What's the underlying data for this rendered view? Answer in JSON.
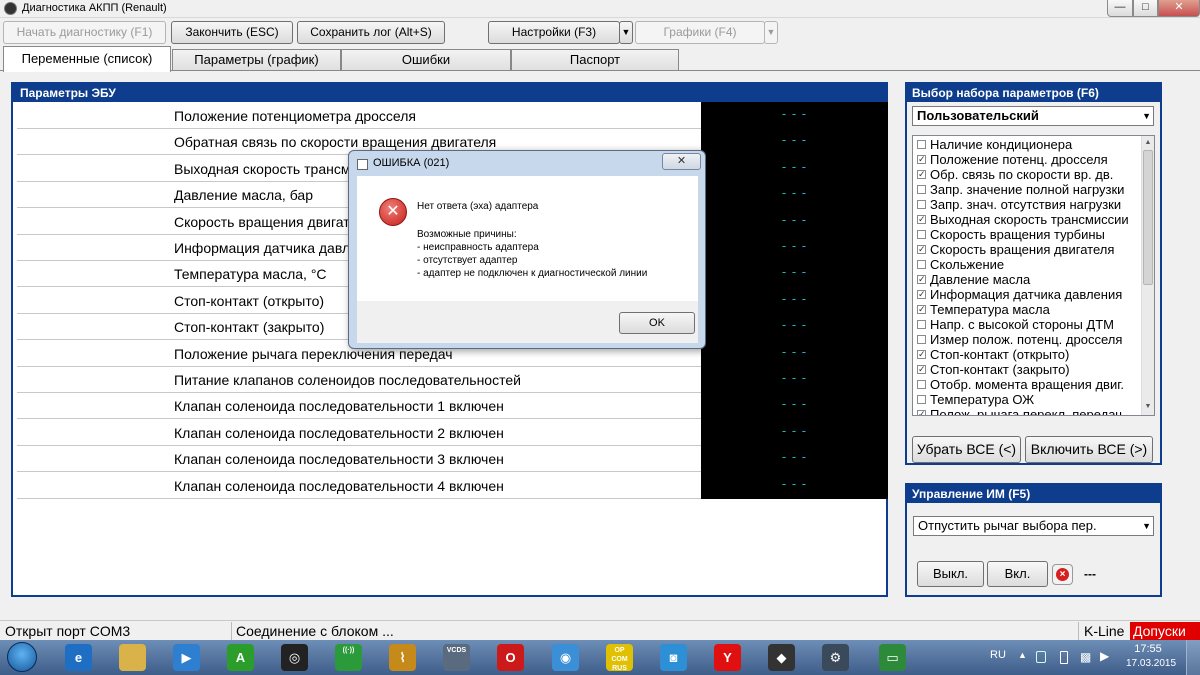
{
  "window": {
    "title": "Диагностика АКПП (Renault)"
  },
  "toolbar": {
    "start_diag": "Начать диагностику (F1)",
    "finish": "Закончить (ESC)",
    "save_log": "Сохранить лог (Alt+S)",
    "settings": "Настройки (F3)",
    "graphs": "Графики (F4)"
  },
  "tabs": [
    {
      "label": "Переменные (список)"
    },
    {
      "label": "Параметры (график)"
    },
    {
      "label": "Ошибки"
    },
    {
      "label": "Паспорт"
    }
  ],
  "ecu_panel": {
    "title": "Параметры ЭБУ",
    "rows": [
      {
        "name": "Положение потенциометра дросселя",
        "value": "- - -"
      },
      {
        "name": "Обратная  связь по скорости вращения двигателя",
        "value": "- - -"
      },
      {
        "name": "Выходная скорость трансмиссии",
        "value": "- - -"
      },
      {
        "name": "Давление масла, бар",
        "value": "- - -"
      },
      {
        "name": "Скорость вращения двигателя",
        "value": "- - -"
      },
      {
        "name": "Информация датчика давления",
        "value": "- - -"
      },
      {
        "name": "Температура масла, °C",
        "value": "- - -"
      },
      {
        "name": "Стоп-контакт (открыто)",
        "value": "- - -"
      },
      {
        "name": "Стоп-контакт (закрыто)",
        "value": "- - -"
      },
      {
        "name": "Положение рычага переключения передач",
        "value": "- - -"
      },
      {
        "name": "Питание клапанов соленоидов последовательностей",
        "value": "- - -"
      },
      {
        "name": "Клапан соленоида последовательности 1 включен",
        "value": "- - -"
      },
      {
        "name": "Клапан соленоида последовательности 2 включен",
        "value": "- - -"
      },
      {
        "name": "Клапан соленоида последовательности 3 включен",
        "value": "- - -"
      },
      {
        "name": "Клапан соленоида последовательности 4 включен",
        "value": "- - -"
      }
    ]
  },
  "param_set": {
    "title": "Выбор набора параметров (F6)",
    "selected": "Пользовательский",
    "items": [
      {
        "label": "Наличие кондиционера",
        "checked": false
      },
      {
        "label": "Положение потенц. дросселя",
        "checked": true
      },
      {
        "label": "Обр.  связь по скорости вр. дв.",
        "checked": true
      },
      {
        "label": "Запр. значение полной нагрузки",
        "checked": false
      },
      {
        "label": "Запр. знач. отсутствия нагрузки",
        "checked": false
      },
      {
        "label": "Выходная скорость трансмиссии",
        "checked": true
      },
      {
        "label": "Скорость вращения турбины",
        "checked": false
      },
      {
        "label": "Скорость вращения двигателя",
        "checked": true
      },
      {
        "label": "Скольжение",
        "checked": false
      },
      {
        "label": "Давление масла",
        "checked": true
      },
      {
        "label": "Информация датчика давления",
        "checked": true
      },
      {
        "label": "Температура масла",
        "checked": true
      },
      {
        "label": "Напр. с высокой стороны ДТМ",
        "checked": false
      },
      {
        "label": "Измер полож. потенц. дросселя",
        "checked": false
      },
      {
        "label": "Стоп-контакт (открыто)",
        "checked": true
      },
      {
        "label": "Стоп-контакт (закрыто)",
        "checked": true
      },
      {
        "label": "Отобр. момента вращения двиг.",
        "checked": false
      },
      {
        "label": "Температура ОЖ",
        "checked": false
      },
      {
        "label": "Полож. рычага перекл. передач",
        "checked": true
      }
    ],
    "remove_all": "Убрать ВСЕ (<)",
    "add_all": "Включить ВСЕ (>)"
  },
  "actuator": {
    "title": "Управление ИМ (F5)",
    "selected": "Отпустить рычаг выбора пер.",
    "off": "Выкл.",
    "on": "Вкл.",
    "state": "---"
  },
  "status": {
    "port": "Открыт порт COM3",
    "connection": "Соединение с блоком ...",
    "protocol": "K-Line",
    "admissions": "Допуски"
  },
  "dialog": {
    "title": "ОШИБКА (021)",
    "message": "Нет ответа (эха) адаптера",
    "reasons_title": "Возможные причины:",
    "reasons": [
      "- неисправность адаптера",
      "- отсутствует адаптер",
      "- адаптер не подключен к диагностической линии"
    ],
    "ok": "OK"
  },
  "taskbar": {
    "icons": [
      {
        "name": "explorer-icon",
        "color": "#1e6fc4",
        "glyph": "e"
      },
      {
        "name": "folder-icon",
        "color": "#d9b24a",
        "glyph": ""
      },
      {
        "name": "media-player-icon",
        "color": "#2f7fd0",
        "glyph": "▶"
      },
      {
        "name": "a-app-icon",
        "color": "#2a9d2a",
        "glyph": "A"
      },
      {
        "name": "disc-tool-icon",
        "color": "#222222",
        "glyph": "◎"
      },
      {
        "name": "radio-icon",
        "color": "#2a9a3a",
        "glyph": "((·))"
      },
      {
        "name": "pulse-icon",
        "color": "#c58a1a",
        "glyph": "⌇"
      },
      {
        "name": "vcds-icon",
        "color": "#5a6b80",
        "glyph": "VCDS"
      },
      {
        "name": "opera-icon",
        "color": "#cc1a1a",
        "glyph": "O"
      },
      {
        "name": "chrome-icon",
        "color": "#3a8fd6",
        "glyph": "◉"
      },
      {
        "name": "opcom-icon",
        "color": "#e0c000",
        "glyph": "OP COM RUS"
      },
      {
        "name": "camera-icon",
        "color": "#2d8fd6",
        "glyph": "◙"
      },
      {
        "name": "yandex-icon",
        "color": "#e01010",
        "glyph": "Y"
      },
      {
        "name": "renault-icon",
        "color": "#333333",
        "glyph": "◆"
      },
      {
        "name": "diag-app-icon",
        "color": "#3a4a5a",
        "glyph": "⚙"
      },
      {
        "name": "monitor-icon",
        "color": "#2d8a3a",
        "glyph": "▭"
      }
    ],
    "lang": "RU",
    "time": "17:55",
    "date": "17.03.2015"
  },
  "colors": {
    "panel_header": "#0d3d8c",
    "value_bg": "#000000",
    "value_text": "#1fb5c8",
    "status_alert": "#e00000"
  }
}
